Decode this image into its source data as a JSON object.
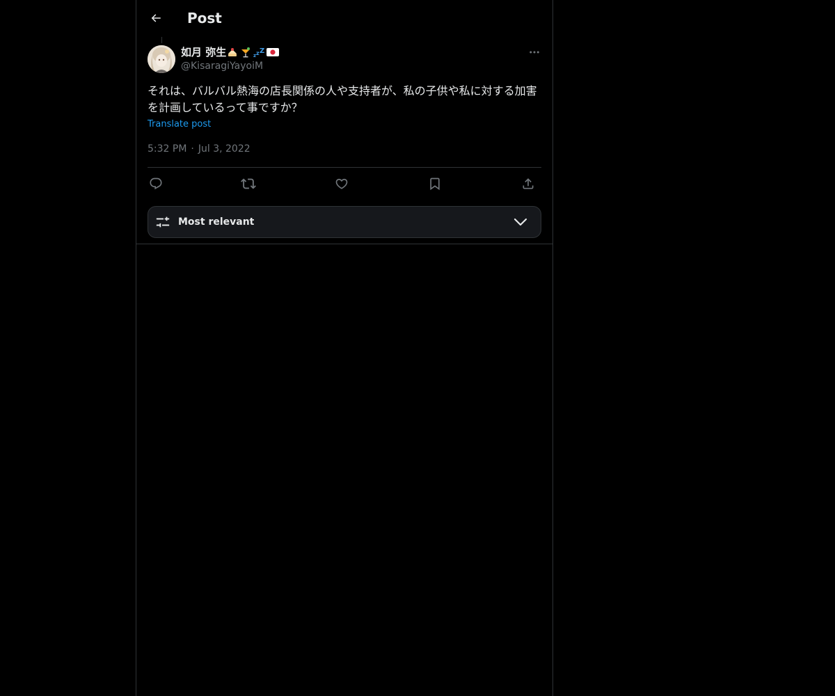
{
  "header": {
    "title": "Post"
  },
  "post": {
    "author_name": "如月 弥生",
    "author_emoji": [
      "🍰",
      "🍹",
      "💤",
      "🇯🇵"
    ],
    "author_handle": "@KisaragiYayoiM",
    "text": "それは、バルバル熱海の店長関係の人や支持者が、私の子供や私に対する加害を計画しているって事ですか？",
    "translate_label": "Translate post",
    "time": "5:32 PM",
    "date": "Jul 3, 2022"
  },
  "sort": {
    "label": "Most relevant"
  },
  "colors": {
    "background": "#000000",
    "text": "#e7e9ea",
    "muted": "#71767b",
    "accent": "#1d9bf0",
    "border": "#2f3336"
  },
  "icons": {
    "back": "arrow-left-icon",
    "more": "more-horizontal-icon",
    "reply": "reply-icon",
    "repost": "repost-icon",
    "like": "heart-icon",
    "bookmark": "bookmark-icon",
    "share": "share-icon",
    "sort": "sliders-icon",
    "chevron": "chevron-down-icon"
  }
}
